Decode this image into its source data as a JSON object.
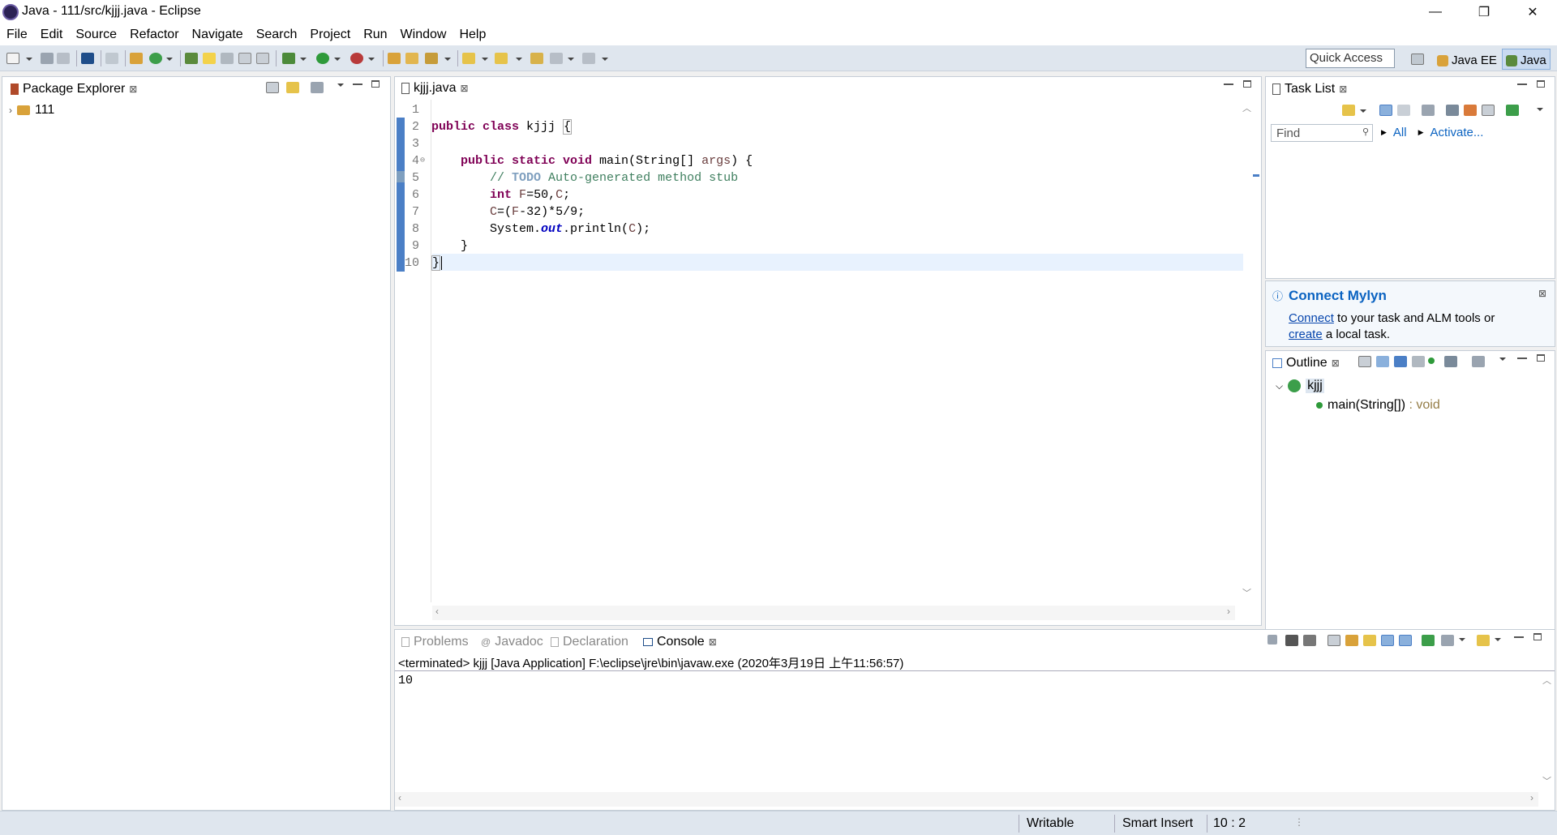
{
  "window": {
    "title": "Java - 111/src/kjjj.java - Eclipse",
    "minimize": "—",
    "restore": "❐",
    "close": "✕"
  },
  "menu": [
    "File",
    "Edit",
    "Source",
    "Refactor",
    "Navigate",
    "Search",
    "Project",
    "Run",
    "Window",
    "Help"
  ],
  "toolbar": {
    "quick_access_placeholder": "Quick Access",
    "perspectives": [
      "Java EE",
      "Java"
    ]
  },
  "package_explorer": {
    "tab": "Package Explorer",
    "tree": [
      {
        "label": "111",
        "expanded": false
      }
    ]
  },
  "editor": {
    "tab": "kjjj.java",
    "lines": [
      {
        "n": "1",
        "html": ""
      },
      {
        "n": "2",
        "html": "public class kjjj {"
      },
      {
        "n": "3",
        "html": ""
      },
      {
        "n": "4",
        "html": "    public static void main(String[] args) {"
      },
      {
        "n": "5",
        "html": "        // TODO Auto-generated method stub"
      },
      {
        "n": "6",
        "html": "        int F=50,C;"
      },
      {
        "n": "7",
        "html": "        C=(F-32)*5/9;"
      },
      {
        "n": "8",
        "html": "        System.out.println(C);"
      },
      {
        "n": "9",
        "html": "    }"
      },
      {
        "n": "10",
        "html": "}"
      }
    ]
  },
  "task_list": {
    "tab": "Task List",
    "find_placeholder": "Find",
    "all_label": "All",
    "activate_label": "Activate..."
  },
  "mylyn": {
    "title": "Connect Mylyn",
    "connect_link": "Connect",
    "text1": " to your task and ALM tools or",
    "create_link": "create",
    "text2": " a local task."
  },
  "outline": {
    "tab": "Outline",
    "class_name": "kjjj",
    "method": "main(String[])",
    "method_type": " : void"
  },
  "bottom_tabs": [
    "Problems",
    "Javadoc",
    "Declaration",
    "Console"
  ],
  "console": {
    "header": "<terminated> kjjj [Java Application] F:\\eclipse\\jre\\bin\\javaw.exe (2020年3月19日 上午11:56:57)",
    "output": "10"
  },
  "status": {
    "writable": "Writable",
    "insert_mode": "Smart Insert",
    "position": "10 : 2"
  },
  "colors": {
    "accent": "#0b63c1",
    "keyword": "#7f0055",
    "comment": "#3f7f5f"
  }
}
